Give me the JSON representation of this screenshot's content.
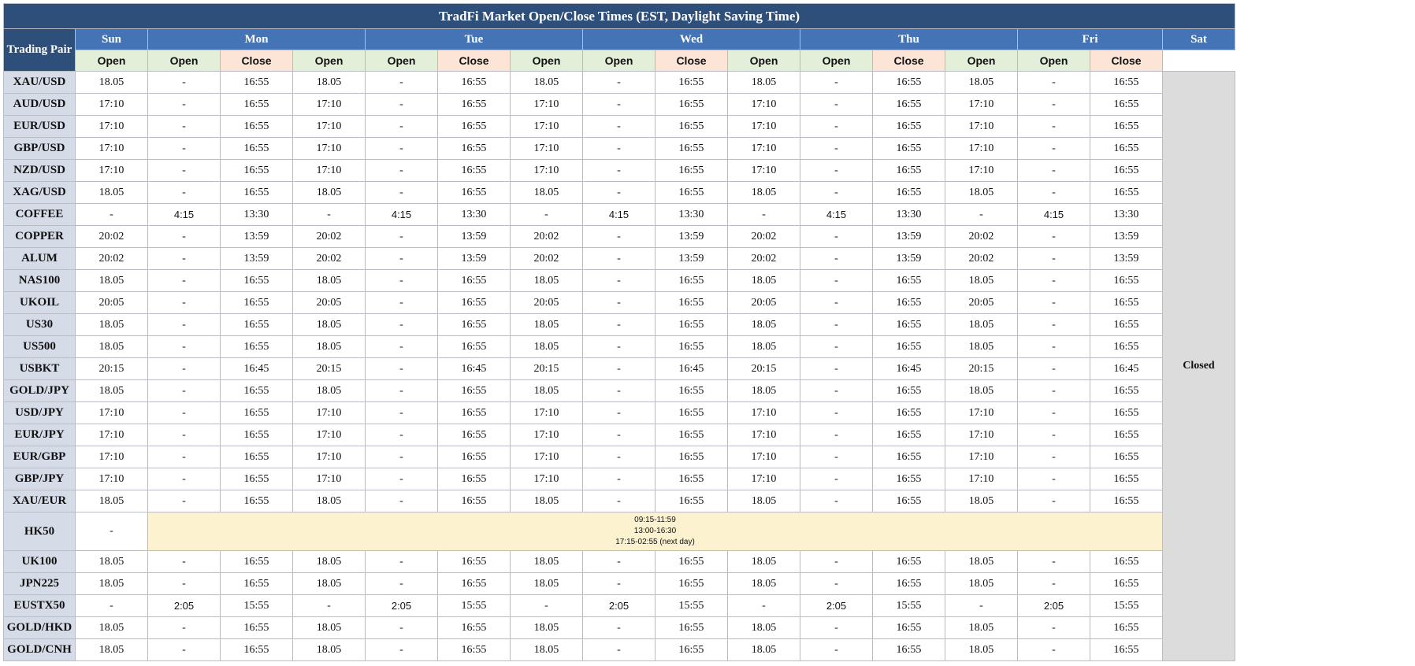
{
  "title": "TradFi Market Open/Close Times (EST, Daylight Saving Time)",
  "header": {
    "trading_pair": "Trading Pair",
    "days": [
      "Sun",
      "Mon",
      "Tue",
      "Wed",
      "Thu",
      "Fri",
      "Sat"
    ],
    "open_label": "Open",
    "close_label": "Close"
  },
  "sat_status": "Closed",
  "hk50_note": [
    "09:15-11:59",
    "13:00-16:30",
    "17:15-02:55 (next day)"
  ],
  "rows": [
    {
      "pair": "XAU/USD",
      "v": [
        "18.05",
        "-",
        "16:55",
        "18.05",
        "-",
        "16:55",
        "18.05",
        "-",
        "16:55",
        "18.05",
        "-",
        "16:55",
        "18.05",
        "-",
        "16:55"
      ]
    },
    {
      "pair": "AUD/USD",
      "v": [
        "17:10",
        "-",
        "16:55",
        "17:10",
        "-",
        "16:55",
        "17:10",
        "-",
        "16:55",
        "17:10",
        "-",
        "16:55",
        "17:10",
        "-",
        "16:55"
      ]
    },
    {
      "pair": "EUR/USD",
      "v": [
        "17:10",
        "-",
        "16:55",
        "17:10",
        "-",
        "16:55",
        "17:10",
        "-",
        "16:55",
        "17:10",
        "-",
        "16:55",
        "17:10",
        "-",
        "16:55"
      ]
    },
    {
      "pair": "GBP/USD",
      "v": [
        "17:10",
        "-",
        "16:55",
        "17:10",
        "-",
        "16:55",
        "17:10",
        "-",
        "16:55",
        "17:10",
        "-",
        "16:55",
        "17:10",
        "-",
        "16:55"
      ]
    },
    {
      "pair": "NZD/USD",
      "v": [
        "17:10",
        "-",
        "16:55",
        "17:10",
        "-",
        "16:55",
        "17:10",
        "-",
        "16:55",
        "17:10",
        "-",
        "16:55",
        "17:10",
        "-",
        "16:55"
      ]
    },
    {
      "pair": "XAG/USD",
      "v": [
        "18.05",
        "-",
        "16:55",
        "18.05",
        "-",
        "16:55",
        "18.05",
        "-",
        "16:55",
        "18.05",
        "-",
        "16:55",
        "18.05",
        "-",
        "16:55"
      ]
    },
    {
      "pair": "COFFEE",
      "v": [
        "-",
        "4:15",
        "13:30",
        "-",
        "4:15",
        "13:30",
        "-",
        "4:15",
        "13:30",
        "-",
        "4:15",
        "13:30",
        "-",
        "4:15",
        "13:30"
      ]
    },
    {
      "pair": "COPPER",
      "v": [
        "20:02",
        "-",
        "13:59",
        "20:02",
        "-",
        "13:59",
        "20:02",
        "-",
        "13:59",
        "20:02",
        "-",
        "13:59",
        "20:02",
        "-",
        "13:59"
      ]
    },
    {
      "pair": "ALUM",
      "v": [
        "20:02",
        "-",
        "13:59",
        "20:02",
        "-",
        "13:59",
        "20:02",
        "-",
        "13:59",
        "20:02",
        "-",
        "13:59",
        "20:02",
        "-",
        "13:59"
      ]
    },
    {
      "pair": "NAS100",
      "v": [
        "18.05",
        "-",
        "16:55",
        "18.05",
        "-",
        "16:55",
        "18.05",
        "-",
        "16:55",
        "18.05",
        "-",
        "16:55",
        "18.05",
        "-",
        "16:55"
      ]
    },
    {
      "pair": "UKOIL",
      "v": [
        "20:05",
        "-",
        "16:55",
        "20:05",
        "-",
        "16:55",
        "20:05",
        "-",
        "16:55",
        "20:05",
        "-",
        "16:55",
        "20:05",
        "-",
        "16:55"
      ]
    },
    {
      "pair": "US30",
      "v": [
        "18.05",
        "-",
        "16:55",
        "18.05",
        "-",
        "16:55",
        "18.05",
        "-",
        "16:55",
        "18.05",
        "-",
        "16:55",
        "18.05",
        "-",
        "16:55"
      ]
    },
    {
      "pair": "US500",
      "v": [
        "18.05",
        "-",
        "16:55",
        "18.05",
        "-",
        "16:55",
        "18.05",
        "-",
        "16:55",
        "18.05",
        "-",
        "16:55",
        "18.05",
        "-",
        "16:55"
      ]
    },
    {
      "pair": "USBKT",
      "v": [
        "20:15",
        "-",
        "16:45",
        "20:15",
        "-",
        "16:45",
        "20:15",
        "-",
        "16:45",
        "20:15",
        "-",
        "16:45",
        "20:15",
        "-",
        "16:45"
      ]
    },
    {
      "pair": "GOLD/JPY",
      "v": [
        "18.05",
        "-",
        "16:55",
        "18.05",
        "-",
        "16:55",
        "18.05",
        "-",
        "16:55",
        "18.05",
        "-",
        "16:55",
        "18.05",
        "-",
        "16:55"
      ]
    },
    {
      "pair": "USD/JPY",
      "v": [
        "17:10",
        "-",
        "16:55",
        "17:10",
        "-",
        "16:55",
        "17:10",
        "-",
        "16:55",
        "17:10",
        "-",
        "16:55",
        "17:10",
        "-",
        "16:55"
      ]
    },
    {
      "pair": "EUR/JPY",
      "v": [
        "17:10",
        "-",
        "16:55",
        "17:10",
        "-",
        "16:55",
        "17:10",
        "-",
        "16:55",
        "17:10",
        "-",
        "16:55",
        "17:10",
        "-",
        "16:55"
      ]
    },
    {
      "pair": "EUR/GBP",
      "v": [
        "17:10",
        "-",
        "16:55",
        "17:10",
        "-",
        "16:55",
        "17:10",
        "-",
        "16:55",
        "17:10",
        "-",
        "16:55",
        "17:10",
        "-",
        "16:55"
      ]
    },
    {
      "pair": "GBP/JPY",
      "v": [
        "17:10",
        "-",
        "16:55",
        "17:10",
        "-",
        "16:55",
        "17:10",
        "-",
        "16:55",
        "17:10",
        "-",
        "16:55",
        "17:10",
        "-",
        "16:55"
      ]
    },
    {
      "pair": "XAU/EUR",
      "v": [
        "18.05",
        "-",
        "16:55",
        "18.05",
        "-",
        "16:55",
        "18.05",
        "-",
        "16:55",
        "18.05",
        "-",
        "16:55",
        "18.05",
        "-",
        "16:55"
      ]
    },
    {
      "pair": "HK50",
      "v": [
        "-"
      ],
      "note": true
    },
    {
      "pair": "UK100",
      "v": [
        "18.05",
        "-",
        "16:55",
        "18.05",
        "-",
        "16:55",
        "18.05",
        "-",
        "16:55",
        "18.05",
        "-",
        "16:55",
        "18.05",
        "-",
        "16:55"
      ]
    },
    {
      "pair": "JPN225",
      "v": [
        "18.05",
        "-",
        "16:55",
        "18.05",
        "-",
        "16:55",
        "18.05",
        "-",
        "16:55",
        "18.05",
        "-",
        "16:55",
        "18.05",
        "-",
        "16:55"
      ]
    },
    {
      "pair": "EUSTX50",
      "v": [
        "-",
        "2:05",
        "15:55",
        "-",
        "2:05",
        "15:55",
        "-",
        "2:05",
        "15:55",
        "-",
        "2:05",
        "15:55",
        "-",
        "2:05",
        "15:55"
      ]
    },
    {
      "pair": "GOLD/HKD",
      "v": [
        "18.05",
        "-",
        "16:55",
        "18.05",
        "-",
        "16:55",
        "18.05",
        "-",
        "16:55",
        "18.05",
        "-",
        "16:55",
        "18.05",
        "-",
        "16:55"
      ]
    },
    {
      "pair": "GOLD/CNH",
      "v": [
        "18.05",
        "-",
        "16:55",
        "18.05",
        "-",
        "16:55",
        "18.05",
        "-",
        "16:55",
        "18.05",
        "-",
        "16:55",
        "18.05",
        "-",
        "16:55"
      ]
    }
  ]
}
